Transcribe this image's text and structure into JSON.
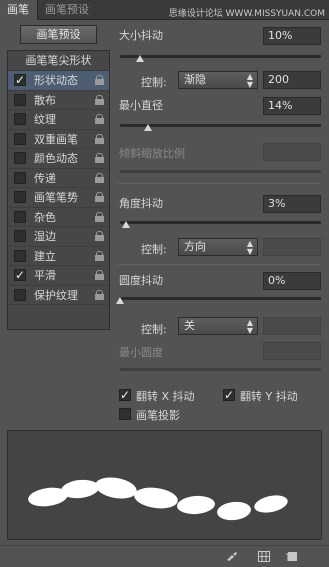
{
  "tabs": {
    "active": "画笔",
    "inactive": "画笔预设"
  },
  "watermark": "思缘设计论坛 WWW.MISSYUAN.COM",
  "preset_button": "画笔预设",
  "list": {
    "header": "画笔笔尖形状",
    "items": [
      {
        "label": "形状动态",
        "checked": true,
        "selected": true
      },
      {
        "label": "散布",
        "checked": false
      },
      {
        "label": "纹理",
        "checked": false
      },
      {
        "label": "双重画笔",
        "checked": false
      },
      {
        "label": "颜色动态",
        "checked": false
      },
      {
        "label": "传递",
        "checked": false
      },
      {
        "label": "画笔笔势",
        "checked": false
      },
      {
        "label": "杂色",
        "checked": false
      },
      {
        "label": "湿边",
        "checked": false
      },
      {
        "label": "建立",
        "checked": false
      },
      {
        "label": "平滑",
        "checked": true
      },
      {
        "label": "保护纹理",
        "checked": false
      }
    ]
  },
  "size_jitter": {
    "label": "大小抖动",
    "value": "10%",
    "slider_fraction": 0.1
  },
  "size_control": {
    "label": "控制:",
    "option": "渐隐",
    "value": "200"
  },
  "min_diameter": {
    "label": "最小直径",
    "value": "14%",
    "slider_fraction": 0.14
  },
  "tilt_scale": {
    "label": "倾斜缩放比例"
  },
  "angle_jitter": {
    "label": "角度抖动",
    "value": "3%",
    "slider_fraction": 0.03
  },
  "angle_control": {
    "label": "控制:",
    "option": "方向"
  },
  "roundness_jitter": {
    "label": "圆度抖动",
    "value": "0%",
    "slider_fraction": 0
  },
  "roundness_control": {
    "label": "控制:",
    "option": "关"
  },
  "min_roundness": {
    "label": "最小圆度"
  },
  "flip_x": {
    "label": "翻转 X 抖动",
    "checked": true
  },
  "flip_y": {
    "label": "翻转 Y 抖动",
    "checked": true
  },
  "brush_projection": {
    "label": "画笔投影",
    "checked": false
  },
  "icons": {
    "panel_menu": "panel-menu-icon",
    "bottom": [
      "toggle-live-tip-icon",
      "grid-icon",
      "new-preset-icon"
    ]
  }
}
